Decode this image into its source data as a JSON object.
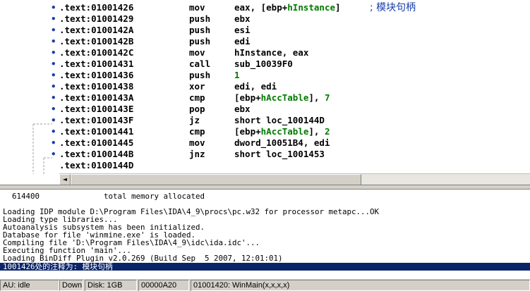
{
  "disassembly": {
    "lines": [
      {
        "addr": ".text:01001426",
        "mnem": "mov",
        "ops": [
          {
            "t": "eax, [ebp+"
          },
          {
            "t": "hInstance",
            "c": "green"
          },
          {
            "t": "]"
          }
        ],
        "comment": "; 模块句柄"
      },
      {
        "addr": ".text:01001429",
        "mnem": "push",
        "ops": [
          {
            "t": "ebx"
          }
        ]
      },
      {
        "addr": ".text:0100142A",
        "mnem": "push",
        "ops": [
          {
            "t": "esi"
          }
        ]
      },
      {
        "addr": ".text:0100142B",
        "mnem": "push",
        "ops": [
          {
            "t": "edi"
          }
        ]
      },
      {
        "addr": ".text:0100142C",
        "mnem": "mov",
        "ops": [
          {
            "t": "hInstance, eax"
          }
        ]
      },
      {
        "addr": ".text:01001431",
        "mnem": "call",
        "ops": [
          {
            "t": "sub_10039F0"
          }
        ]
      },
      {
        "addr": ".text:01001436",
        "mnem": "push",
        "ops": [
          {
            "t": "1",
            "c": "green"
          }
        ]
      },
      {
        "addr": ".text:01001438",
        "mnem": "xor",
        "ops": [
          {
            "t": "edi, edi"
          }
        ]
      },
      {
        "addr": ".text:0100143A",
        "mnem": "cmp",
        "ops": [
          {
            "t": "[ebp+"
          },
          {
            "t": "hAccTable",
            "c": "green"
          },
          {
            "t": "], "
          },
          {
            "t": "7",
            "c": "green"
          }
        ]
      },
      {
        "addr": ".text:0100143E",
        "mnem": "pop",
        "ops": [
          {
            "t": "ebx"
          }
        ]
      },
      {
        "addr": ".text:0100143F",
        "mnem": "jz",
        "ops": [
          {
            "t": "short loc_100144D"
          }
        ]
      },
      {
        "addr": ".text:01001441",
        "mnem": "cmp",
        "ops": [
          {
            "t": "[ebp+"
          },
          {
            "t": "hAccTable",
            "c": "green"
          },
          {
            "t": "], "
          },
          {
            "t": "2",
            "c": "green"
          }
        ]
      },
      {
        "addr": ".text:01001445",
        "mnem": "mov",
        "ops": [
          {
            "t": "dword_10051B4, edi"
          }
        ]
      },
      {
        "addr": ".text:0100144B",
        "mnem": "jnz",
        "ops": [
          {
            "t": "short loc_1001453"
          }
        ]
      },
      {
        "addr": ".text:0100144D",
        "mnem": "",
        "ops": [],
        "nodot": true
      }
    ]
  },
  "output": {
    "memory_line": "  614400              total memory allocated",
    "messages": [
      "Loading IDP module D:\\Program Files\\IDA\\4_9\\procs\\pc.w32 for processor metapc...OK",
      "Loading type libraries...",
      "Autoanalysis subsystem has been initialized.",
      "Database for file 'winmine.exe' is loaded.",
      "Compiling file 'D:\\Program Files\\IDA\\4_9\\idc\\ida.idc'...",
      "Executing function 'main'...",
      "Loading BinDiff Plugin v2.0.269 (Build Sep  5 2007, 12:01:01)"
    ],
    "selected": "1001426处的注释为: 模块句柄"
  },
  "statusbar": {
    "au": "AU:  idle",
    "direction": "Down",
    "disk": "Disk: 1GB",
    "offset": "00000A20",
    "location": "01001420: WinMain(x,x,x,x)"
  },
  "colors": {
    "keyword_blue": "#1a3fa8",
    "value_green": "#007a00",
    "selection": "#0a246a"
  }
}
